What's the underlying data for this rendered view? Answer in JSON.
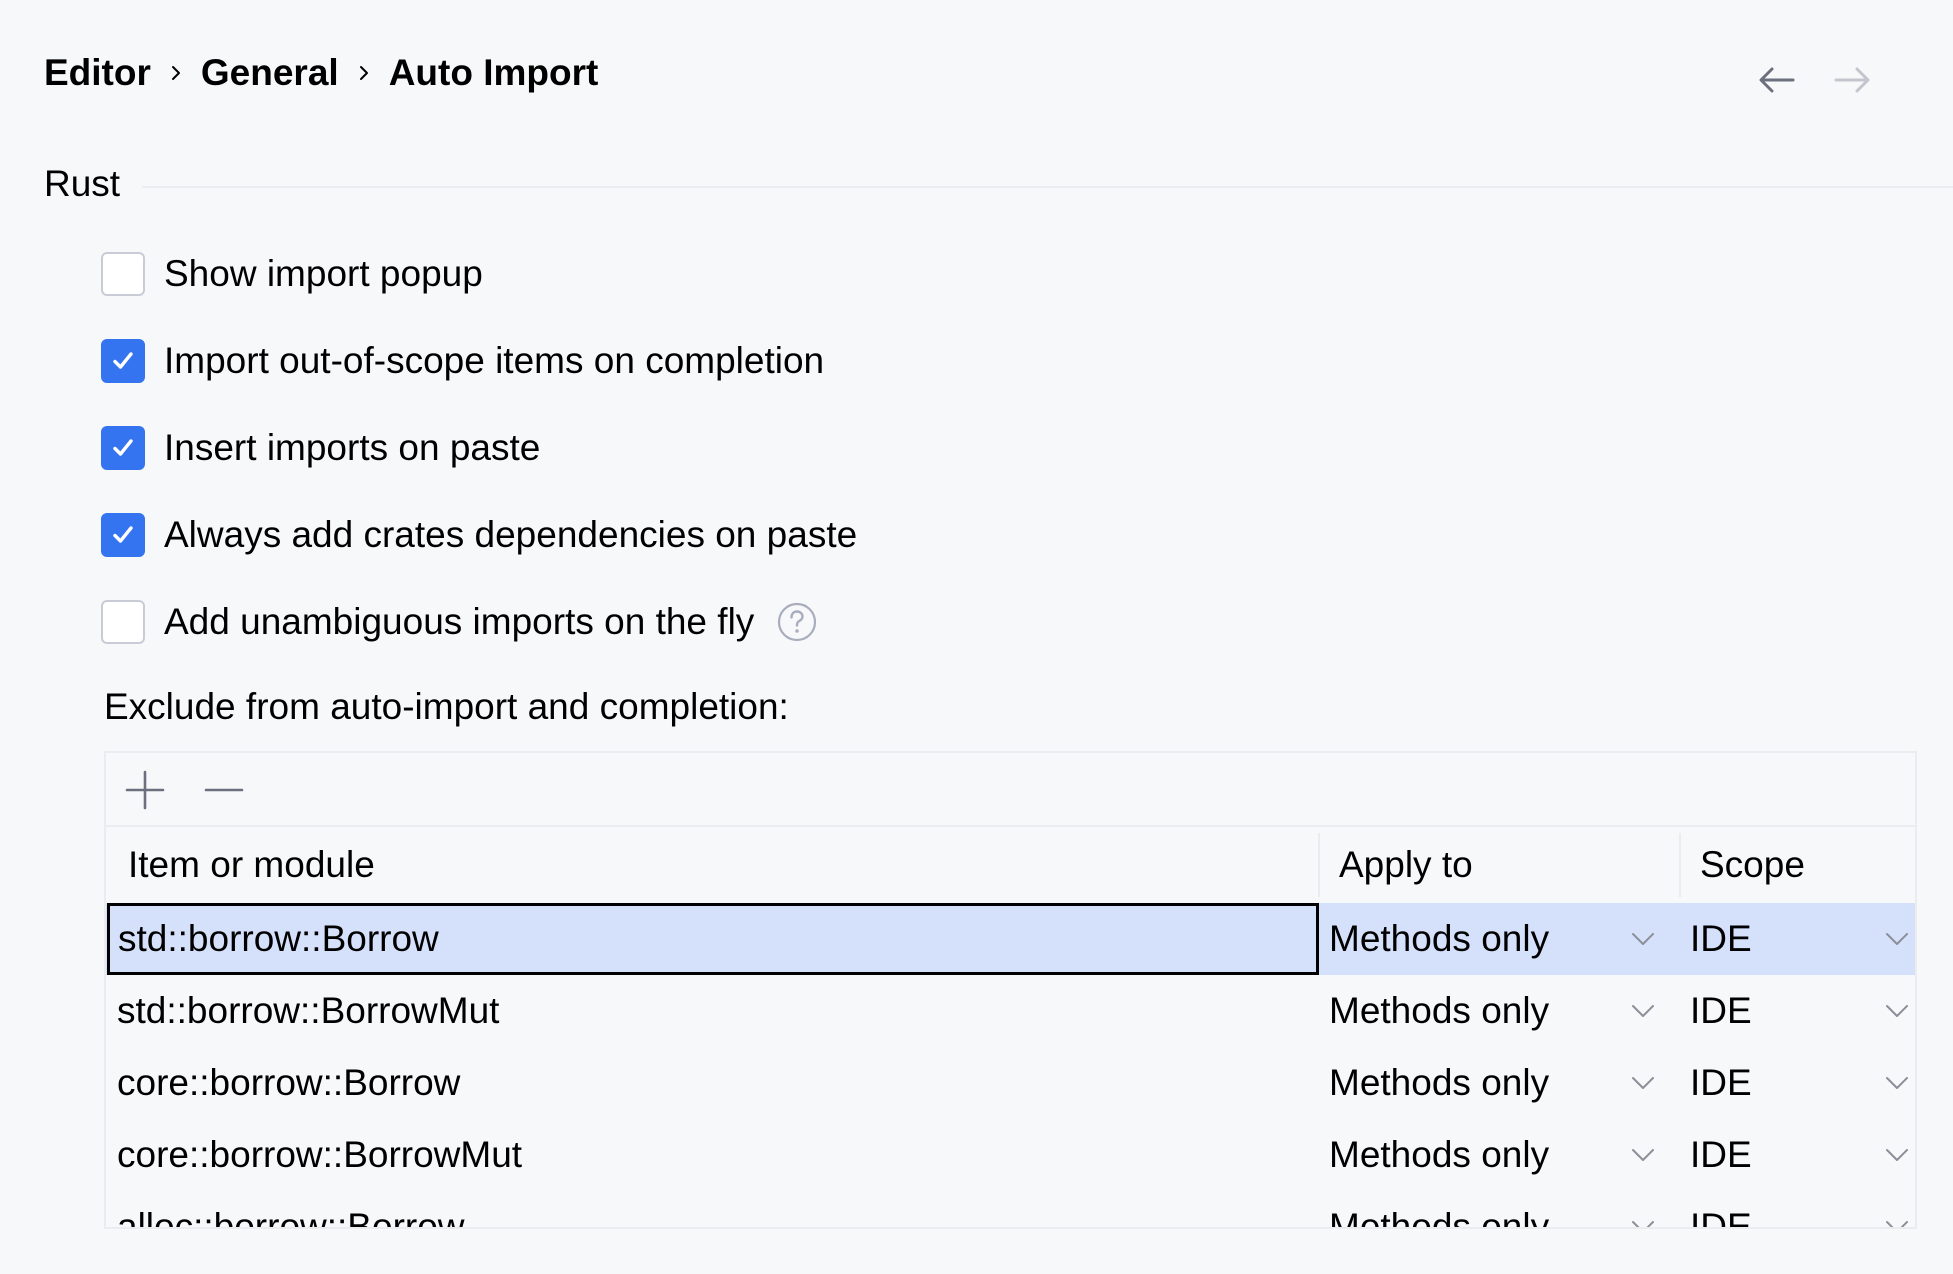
{
  "breadcrumb": {
    "items": [
      "Editor",
      "General",
      "Auto Import"
    ],
    "separator_icon": "chevron-right-icon"
  },
  "navigation": {
    "back_icon": "arrow-left-icon",
    "forward_icon": "arrow-right-icon",
    "back_enabled": true,
    "forward_enabled": false
  },
  "section": {
    "title": "Rust"
  },
  "options": [
    {
      "label": "Show import popup",
      "checked": false
    },
    {
      "label": "Import out-of-scope items on completion",
      "checked": true
    },
    {
      "label": "Insert imports on paste",
      "checked": true
    },
    {
      "label": "Always add crates dependencies on paste",
      "checked": true
    },
    {
      "label": "Add unambiguous imports on the fly",
      "checked": false,
      "help_icon": "question-circle-icon"
    }
  ],
  "exclude": {
    "label": "Exclude from auto-import and completion:",
    "toolbar": {
      "add_icon": "plus-icon",
      "remove_icon": "minus-icon"
    },
    "columns": [
      "Item or module",
      "Apply to",
      "Scope"
    ],
    "rows": [
      {
        "item": "std::borrow::Borrow",
        "apply_to": "Methods only",
        "scope": "IDE",
        "selected": true
      },
      {
        "item": "std::borrow::BorrowMut",
        "apply_to": "Methods only",
        "scope": "IDE",
        "selected": false
      },
      {
        "item": "core::borrow::Borrow",
        "apply_to": "Methods only",
        "scope": "IDE",
        "selected": false
      },
      {
        "item": "core::borrow::BorrowMut",
        "apply_to": "Methods only",
        "scope": "IDE",
        "selected": false
      },
      {
        "item": "alloc::borrow::Borrow",
        "apply_to": "Methods only",
        "scope": "IDE",
        "selected": false
      }
    ]
  },
  "colors": {
    "background": "#f7f8fa",
    "accent": "#3574f0",
    "selection": "#d5e0fb",
    "border": "#ebecf0"
  }
}
